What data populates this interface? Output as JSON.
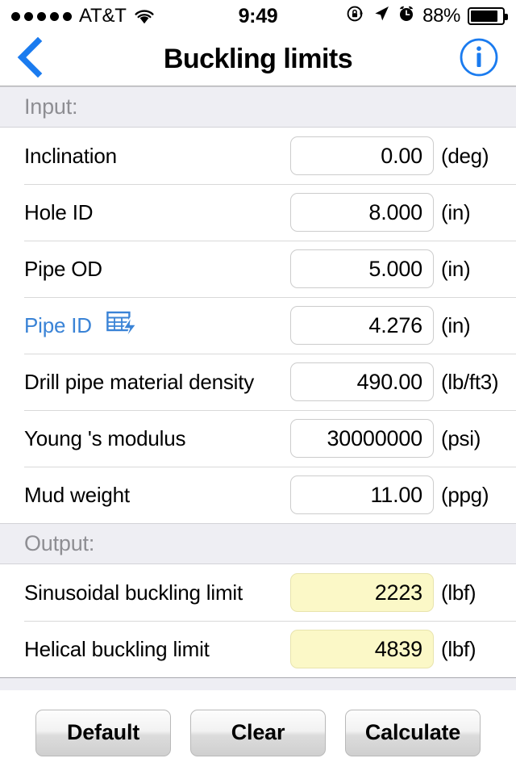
{
  "statusbar": {
    "signal_dots": 5,
    "carrier": "AT&T",
    "wifi_icon": "wifi-icon",
    "time": "9:49",
    "rotation_lock_icon": "rotation-lock-icon",
    "location_icon": "location-arrow-icon",
    "alarm_icon": "alarm-clock-icon",
    "battery_percent": "88%",
    "battery_level": 88
  },
  "navbar": {
    "back_icon": "chevron-left-icon",
    "title": "Buckling limits",
    "info_icon": "info-circle-icon",
    "accent_color": "#1a7bef"
  },
  "input_section": {
    "header": "Input:",
    "rows": [
      {
        "label": "Inclination",
        "value": "0.00",
        "unit": "(deg)",
        "link": false,
        "icon": null
      },
      {
        "label": "Hole ID",
        "value": "8.000",
        "unit": "(in)",
        "link": false,
        "icon": null
      },
      {
        "label": "Pipe OD",
        "value": "5.000",
        "unit": "(in)",
        "link": false,
        "icon": null
      },
      {
        "label": "Pipe ID",
        "value": "4.276",
        "unit": "(in)",
        "link": true,
        "icon": "table-lightning-icon"
      },
      {
        "label": "Drill pipe material density",
        "value": "490.00",
        "unit": "(lb/ft3)",
        "link": false,
        "icon": null
      },
      {
        "label": "Young 's modulus",
        "value": "30000000",
        "unit": "(psi)",
        "link": false,
        "icon": null
      },
      {
        "label": "Mud weight",
        "value": "11.00",
        "unit": "(ppg)",
        "link": false,
        "icon": null
      }
    ]
  },
  "output_section": {
    "header": "Output:",
    "highlight_color": "#fbf8c7",
    "rows": [
      {
        "label": "Sinusoidal buckling limit",
        "value": "2223",
        "unit": "(lbf)"
      },
      {
        "label": "Helical buckling limit",
        "value": "4839",
        "unit": "(lbf)"
      }
    ]
  },
  "toolbar": {
    "buttons": [
      {
        "label": "Default",
        "name": "default-button"
      },
      {
        "label": "Clear",
        "name": "clear-button"
      },
      {
        "label": "Calculate",
        "name": "calculate-button"
      }
    ]
  }
}
